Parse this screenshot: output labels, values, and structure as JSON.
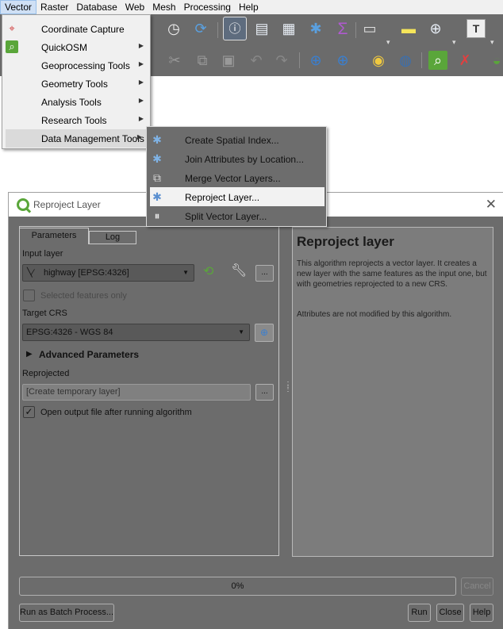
{
  "menubar": {
    "items": [
      "Vector",
      "Raster",
      "Database",
      "Web",
      "Mesh",
      "Processing",
      "Help"
    ],
    "active": "Vector"
  },
  "vector_menu": {
    "items": [
      {
        "label": "Coordinate Capture",
        "icon": "coordinate-capture-icon",
        "has_submenu": false
      },
      {
        "label": "QuickOSM",
        "icon": "quickosm-icon",
        "has_submenu": true
      },
      {
        "label": "Geoprocessing Tools",
        "icon": "",
        "has_submenu": true
      },
      {
        "label": "Geometry Tools",
        "icon": "",
        "has_submenu": true
      },
      {
        "label": "Analysis Tools",
        "icon": "",
        "has_submenu": true
      },
      {
        "label": "Research Tools",
        "icon": "",
        "has_submenu": true
      },
      {
        "label": "Data Management Tools",
        "icon": "",
        "has_submenu": true
      }
    ]
  },
  "data_management_submenu": {
    "items": [
      {
        "label": "Create Spatial Index...",
        "icon": "gear-icon"
      },
      {
        "label": "Join Attributes by Location...",
        "icon": "gear-icon"
      },
      {
        "label": "Merge Vector Layers...",
        "icon": "merge-icon"
      },
      {
        "label": "Reproject Layer...",
        "icon": "gear-icon"
      },
      {
        "label": "Split Vector Layer...",
        "icon": "split-icon"
      }
    ],
    "highlighted": "Reproject Layer..."
  },
  "dialog": {
    "title": "Reproject Layer",
    "tabs": [
      "Parameters",
      "Log"
    ],
    "input_layer_label": "Input layer",
    "input_layer_value": "highway [EPSG:4326]",
    "selected_features_label": "Selected features only",
    "target_crs_label": "Target CRS",
    "target_crs_value": "EPSG:4326 - WGS 84",
    "advanced_label": "Advanced Parameters",
    "reprojected_label": "Reprojected",
    "reprojected_placeholder": "[Create temporary layer]",
    "open_output_label": "Open output file after running algorithm",
    "open_output_checked": true,
    "ellipsis": "...",
    "help_title": "Reproject layer",
    "help_p1": "This algorithm reprojects a vector layer. It creates a new layer with the same features as the input one, but with geometries reprojected to a new CRS.",
    "help_p2": "Attributes are not modified by this algorithm.",
    "progress_text": "0%",
    "progress": 0,
    "cancel_label": "Cancel",
    "batch_label": "Run as Batch Process...",
    "run_label": "Run",
    "close_label": "Close",
    "help_label": "Help"
  },
  "colors": {
    "dialog_bg": "#6c6c6c",
    "toolbar_bg": "#6b6b6b",
    "menu_highlight": "#dadada"
  }
}
